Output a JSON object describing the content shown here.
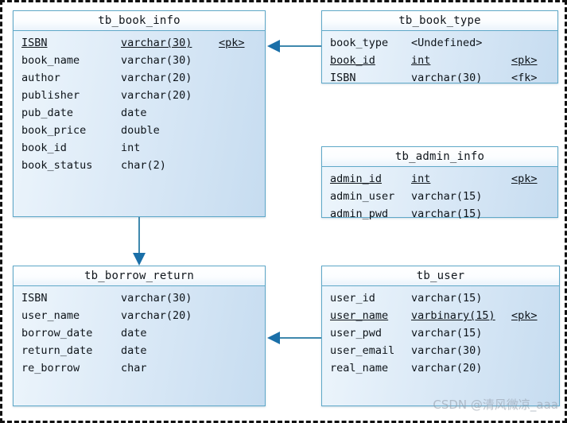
{
  "diagram": {
    "type": "entity-relationship-diagram",
    "watermark": "CSDN @清风微凉_aaa",
    "colors": {
      "entity_border": "#5fa8c8",
      "entity_body_fill": "#dceaf7",
      "entity_header_fill": "#ffffff",
      "connector": "#3f88ad",
      "arrow": "#1a6fa8",
      "frame_border": "#111111"
    }
  },
  "entities": {
    "book_info": {
      "title": "tb_book_info",
      "attributes": [
        {
          "name": "ISBN",
          "type": "varchar(30)",
          "key": "<pk>",
          "is_key": true
        },
        {
          "name": "book_name",
          "type": "varchar(30)",
          "key": "",
          "is_key": false
        },
        {
          "name": "author",
          "type": "varchar(20)",
          "key": "",
          "is_key": false
        },
        {
          "name": "publisher",
          "type": "varchar(20)",
          "key": "",
          "is_key": false
        },
        {
          "name": "pub_date",
          "type": "date",
          "key": "",
          "is_key": false
        },
        {
          "name": "book_price",
          "type": "double",
          "key": "",
          "is_key": false
        },
        {
          "name": "book_id",
          "type": "int",
          "key": "",
          "is_key": false
        },
        {
          "name": "book_status",
          "type": "char(2)",
          "key": "",
          "is_key": false
        }
      ]
    },
    "book_type": {
      "title": "tb_book_type",
      "attributes": [
        {
          "name": "book_type",
          "type": "<Undefined>",
          "key": "",
          "is_key": false
        },
        {
          "name": "book_id",
          "type": "int",
          "key": "<pk>",
          "is_key": true
        },
        {
          "name": "ISBN",
          "type": "varchar(30)",
          "key": "<fk>",
          "is_key": false
        }
      ]
    },
    "admin_info": {
      "title": "tb_admin_info",
      "attributes": [
        {
          "name": "admin_id",
          "type": "int",
          "key": "<pk>",
          "is_key": true
        },
        {
          "name": "admin_user",
          "type": "varchar(15)",
          "key": "",
          "is_key": false
        },
        {
          "name": "admin_pwd",
          "type": "varchar(15)",
          "key": "",
          "is_key": false
        }
      ]
    },
    "borrow_return": {
      "title": "tb_borrow_return",
      "attributes": [
        {
          "name": "ISBN",
          "type": "varchar(30)",
          "key": "",
          "is_key": false
        },
        {
          "name": "user_name",
          "type": "varchar(20)",
          "key": "",
          "is_key": false
        },
        {
          "name": "borrow_date",
          "type": "date",
          "key": "",
          "is_key": false
        },
        {
          "name": "return_date",
          "type": "date",
          "key": "",
          "is_key": false
        },
        {
          "name": "re_borrow",
          "type": "char",
          "key": "",
          "is_key": false
        }
      ]
    },
    "user": {
      "title": "tb_user",
      "attributes": [
        {
          "name": "user_id",
          "type": "varchar(15)",
          "key": "",
          "is_key": false
        },
        {
          "name": "user_name",
          "type": "varbinary(15)",
          "key": "<pk>",
          "is_key": true
        },
        {
          "name": "user_pwd",
          "type": "varchar(15)",
          "key": "",
          "is_key": false
        },
        {
          "name": "user_email",
          "type": "varchar(30)",
          "key": "",
          "is_key": false
        },
        {
          "name": "real_name",
          "type": "varchar(20)",
          "key": "",
          "is_key": false
        }
      ]
    }
  },
  "relationships": [
    {
      "from": "tb_book_type",
      "to": "tb_book_info",
      "direction": "left"
    },
    {
      "from": "tb_book_info",
      "to": "tb_borrow_return",
      "direction": "down"
    },
    {
      "from": "tb_user",
      "to": "tb_borrow_return",
      "direction": "left"
    }
  ]
}
